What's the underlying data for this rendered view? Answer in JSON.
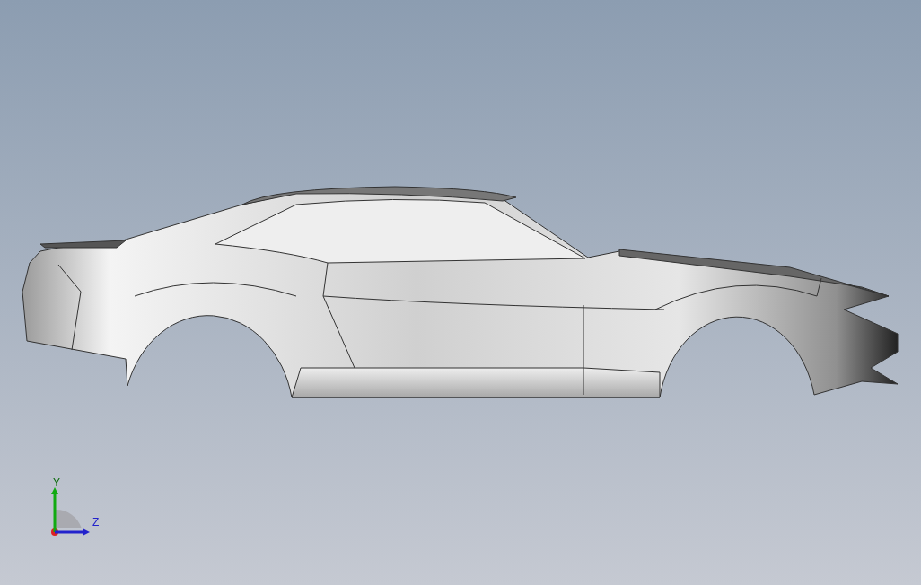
{
  "triad": {
    "vertical_axis": "Y",
    "horizontal_axis": "Z"
  }
}
